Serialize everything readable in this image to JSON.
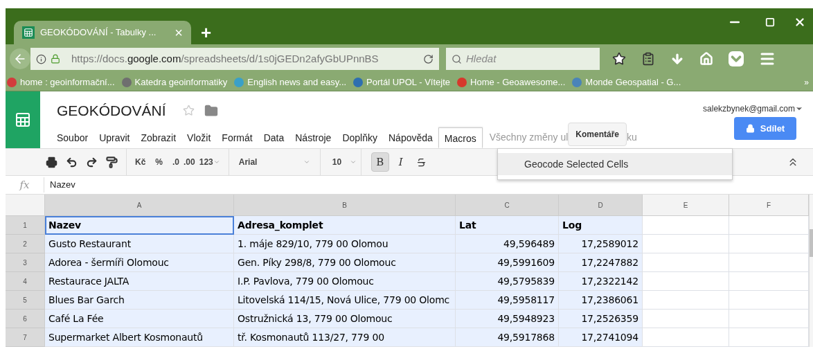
{
  "browser": {
    "tab": {
      "title": "GEOKÓDOVÁNÍ - Tabulky ...",
      "close": "×",
      "selected": true
    },
    "new_tab": "+",
    "url": "https://docs.**google.com**/spreadsheets/d/1s0jGEDn2afyGbUPnnBS",
    "search": {
      "placeholder": "Hledat"
    },
    "bookmarks": [
      {
        "label": "home : geoinformační...",
        "color": "#d23c3c"
      },
      {
        "label": "Katedra geoinformatiky",
        "color": "#6f6f6f"
      },
      {
        "label": "English news and easy...",
        "color": "#3aa0c8"
      },
      {
        "label": "Portál UPOL - Vítejte",
        "color": "#2e6fb0"
      },
      {
        "label": "Home - Geoawesome...",
        "color": "#d6382c"
      },
      {
        "label": "Monde Geospatial - G...",
        "color": "#4a84b8"
      }
    ],
    "bookmarks_more": "»"
  },
  "document": {
    "title": "GEOKÓDOVÁNÍ",
    "starred": false,
    "account": "salekzbynek@gmail.com",
    "menus": [
      {
        "label": "Soubor",
        "open": false
      },
      {
        "label": "Upravit",
        "open": false
      },
      {
        "label": "Zobrazit",
        "open": false
      },
      {
        "label": "Vložit",
        "open": false
      },
      {
        "label": "Formát",
        "open": false
      },
      {
        "label": "Data",
        "open": false
      },
      {
        "label": "Nástroje",
        "open": false
      },
      {
        "label": "Doplňky",
        "open": false
      },
      {
        "label": "Nápověda",
        "open": false
      },
      {
        "label": "Macros",
        "open": true
      }
    ],
    "save_status": "Všechny změny ul",
    "save_status_tail": "ku",
    "comments_button": "Komentáře",
    "share_button": "Sdílet",
    "open_menu_items": [
      "Geocode Selected Cells"
    ]
  },
  "toolbar": {
    "currency": "Kč",
    "percent": "%",
    "decrease_decimals": ".0",
    "increase_decimals": ".00",
    "number_format": "123",
    "font": "Arial",
    "font_size": "10",
    "bold": {
      "label": "B",
      "on": true
    },
    "italic": {
      "label": "I",
      "on": false
    },
    "strike": {
      "on": false
    }
  },
  "formula_bar": {
    "label": "fx",
    "value": "Nazev"
  },
  "sheet": {
    "columns": [
      {
        "label": "A",
        "selected": true,
        "kind": "text"
      },
      {
        "label": "B",
        "selected": true,
        "kind": "text"
      },
      {
        "label": "C",
        "selected": true,
        "kind": "number"
      },
      {
        "label": "D",
        "selected": true,
        "kind": "number"
      },
      {
        "label": "E",
        "selected": false,
        "kind": "text"
      },
      {
        "label": "F",
        "selected": false,
        "kind": "text"
      }
    ],
    "rows": [
      {
        "number": "1",
        "kind": "header",
        "selected": true,
        "cells": [
          {
            "text": "Nazev",
            "active": true
          },
          {
            "text": "Adresa_komplet",
            "active": false
          },
          {
            "text": "Lat",
            "active": false
          },
          {
            "text": "Log",
            "active": false
          }
        ]
      },
      {
        "number": "2",
        "kind": "data",
        "selected": true,
        "cells": [
          {
            "text": "Gusto Restaurant",
            "active": false
          },
          {
            "text": "1. máje 829/10, 779 00 Olomou",
            "active": false
          },
          {
            "text": "49,596489",
            "active": false
          },
          {
            "text": "17,2589012",
            "active": false
          }
        ]
      },
      {
        "number": "3",
        "kind": "data",
        "selected": true,
        "cells": [
          {
            "text": "Adorea - šermíři Olomouc",
            "active": false
          },
          {
            "text": "Gen. Píky 298/8, 779 00 Olomouc",
            "active": false
          },
          {
            "text": "49,5991609",
            "active": false
          },
          {
            "text": "17,2247882",
            "active": false
          }
        ]
      },
      {
        "number": "4",
        "kind": "data",
        "selected": true,
        "cells": [
          {
            "text": "Restaurace JALTA",
            "active": false
          },
          {
            "text": "I.P. Pavlova, 779 00 Olomouc",
            "active": false
          },
          {
            "text": "49,5795839",
            "active": false
          },
          {
            "text": "17,2322142",
            "active": false
          }
        ]
      },
      {
        "number": "5",
        "kind": "data",
        "selected": true,
        "cells": [
          {
            "text": "Blues Bar Garch",
            "active": false
          },
          {
            "text": "Litovelská 114/15, Nová Ulice, 779 00 Olomc",
            "active": false
          },
          {
            "text": "49,5958117",
            "active": false
          },
          {
            "text": "17,2386061",
            "active": false
          }
        ]
      },
      {
        "number": "6",
        "kind": "data",
        "selected": true,
        "cells": [
          {
            "text": "Café La Fée",
            "active": false
          },
          {
            "text": "Ostružnická 13, 779 00 Olomouc",
            "active": false
          },
          {
            "text": "49,5948923",
            "active": false
          },
          {
            "text": "17,2526359",
            "active": false
          }
        ]
      },
      {
        "number": "7",
        "kind": "data",
        "selected": true,
        "cells": [
          {
            "text": "Supermarket Albert Kosmonautů",
            "active": false
          },
          {
            "text": "tř. Kosmonautů 113/27, 779 00",
            "active": false
          },
          {
            "text": "49,5917868",
            "active": false
          },
          {
            "text": "17,2741094",
            "active": false
          }
        ]
      }
    ]
  }
}
